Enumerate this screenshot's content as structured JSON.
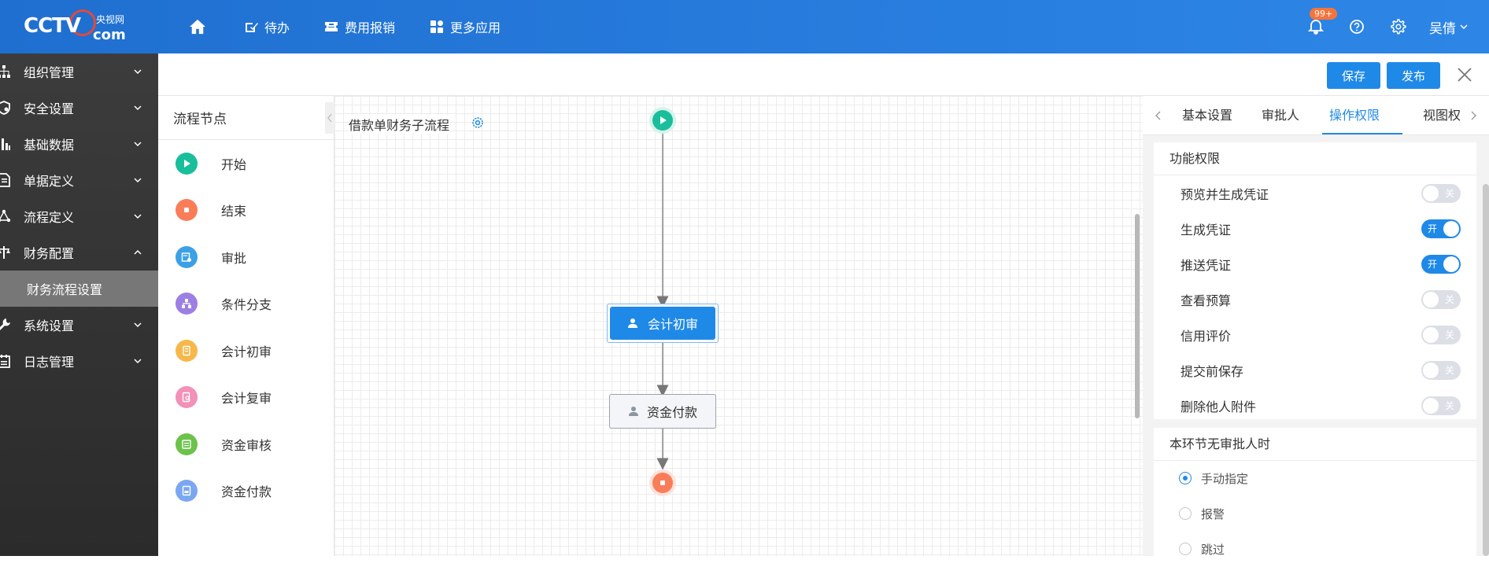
{
  "brand": {
    "logo_main": "CCTV",
    "logo_cn": "央视网",
    "logo_com": "com",
    "accent": "#1f89e8"
  },
  "nav": {
    "items": [
      {
        "label": "待办"
      },
      {
        "label": "费用报销"
      },
      {
        "label": "更多应用"
      }
    ]
  },
  "header": {
    "notification_badge": "99+",
    "username": "吴倩"
  },
  "sidebar": {
    "items": [
      {
        "label": "组织管理"
      },
      {
        "label": "安全设置"
      },
      {
        "label": "基础数据"
      },
      {
        "label": "单据定义"
      },
      {
        "label": "流程定义"
      },
      {
        "label": "财务配置"
      },
      {
        "label": "财务流程设置"
      },
      {
        "label": "系统设置"
      },
      {
        "label": "日志管理"
      }
    ]
  },
  "toolbar": {
    "save_label": "保存",
    "publish_label": "发布"
  },
  "nodes_panel": {
    "title": "流程节点",
    "items": [
      {
        "label": "开始",
        "color": "#19be9b"
      },
      {
        "label": "结束",
        "color": "#fa7d5a"
      },
      {
        "label": "审批",
        "color": "#3ba0e6"
      },
      {
        "label": "条件分支",
        "color": "#9b7fe3"
      },
      {
        "label": "会计初审",
        "color": "#f7b84b"
      },
      {
        "label": "会计复审",
        "color": "#f391b8"
      },
      {
        "label": "资金审核",
        "color": "#6cc24a"
      },
      {
        "label": "资金付款",
        "color": "#7aa7f0"
      }
    ]
  },
  "canvas": {
    "title": "借款单财务子流程",
    "nodes": {
      "first": "会计初审",
      "second": "资金付款"
    }
  },
  "panel": {
    "tabs": [
      {
        "label": "基本设置"
      },
      {
        "label": "审批人"
      },
      {
        "label": "操作权限"
      },
      {
        "label": "视图权"
      }
    ],
    "active_tab": "操作权限",
    "permissions_title": "功能权限",
    "on_text": "开",
    "off_text": "关",
    "permissions": [
      {
        "label": "预览并生成凭证",
        "on": false
      },
      {
        "label": "生成凭证",
        "on": true
      },
      {
        "label": "推送凭证",
        "on": true
      },
      {
        "label": "查看预算",
        "on": false
      },
      {
        "label": "信用评价",
        "on": false
      },
      {
        "label": "提交前保存",
        "on": false
      },
      {
        "label": "删除他人附件",
        "on": false
      }
    ],
    "no_approver_title": "本环节无审批人时",
    "no_approver_options": [
      {
        "label": "手动指定",
        "checked": true
      },
      {
        "label": "报警",
        "checked": false
      },
      {
        "label": "跳过",
        "checked": false
      }
    ]
  }
}
